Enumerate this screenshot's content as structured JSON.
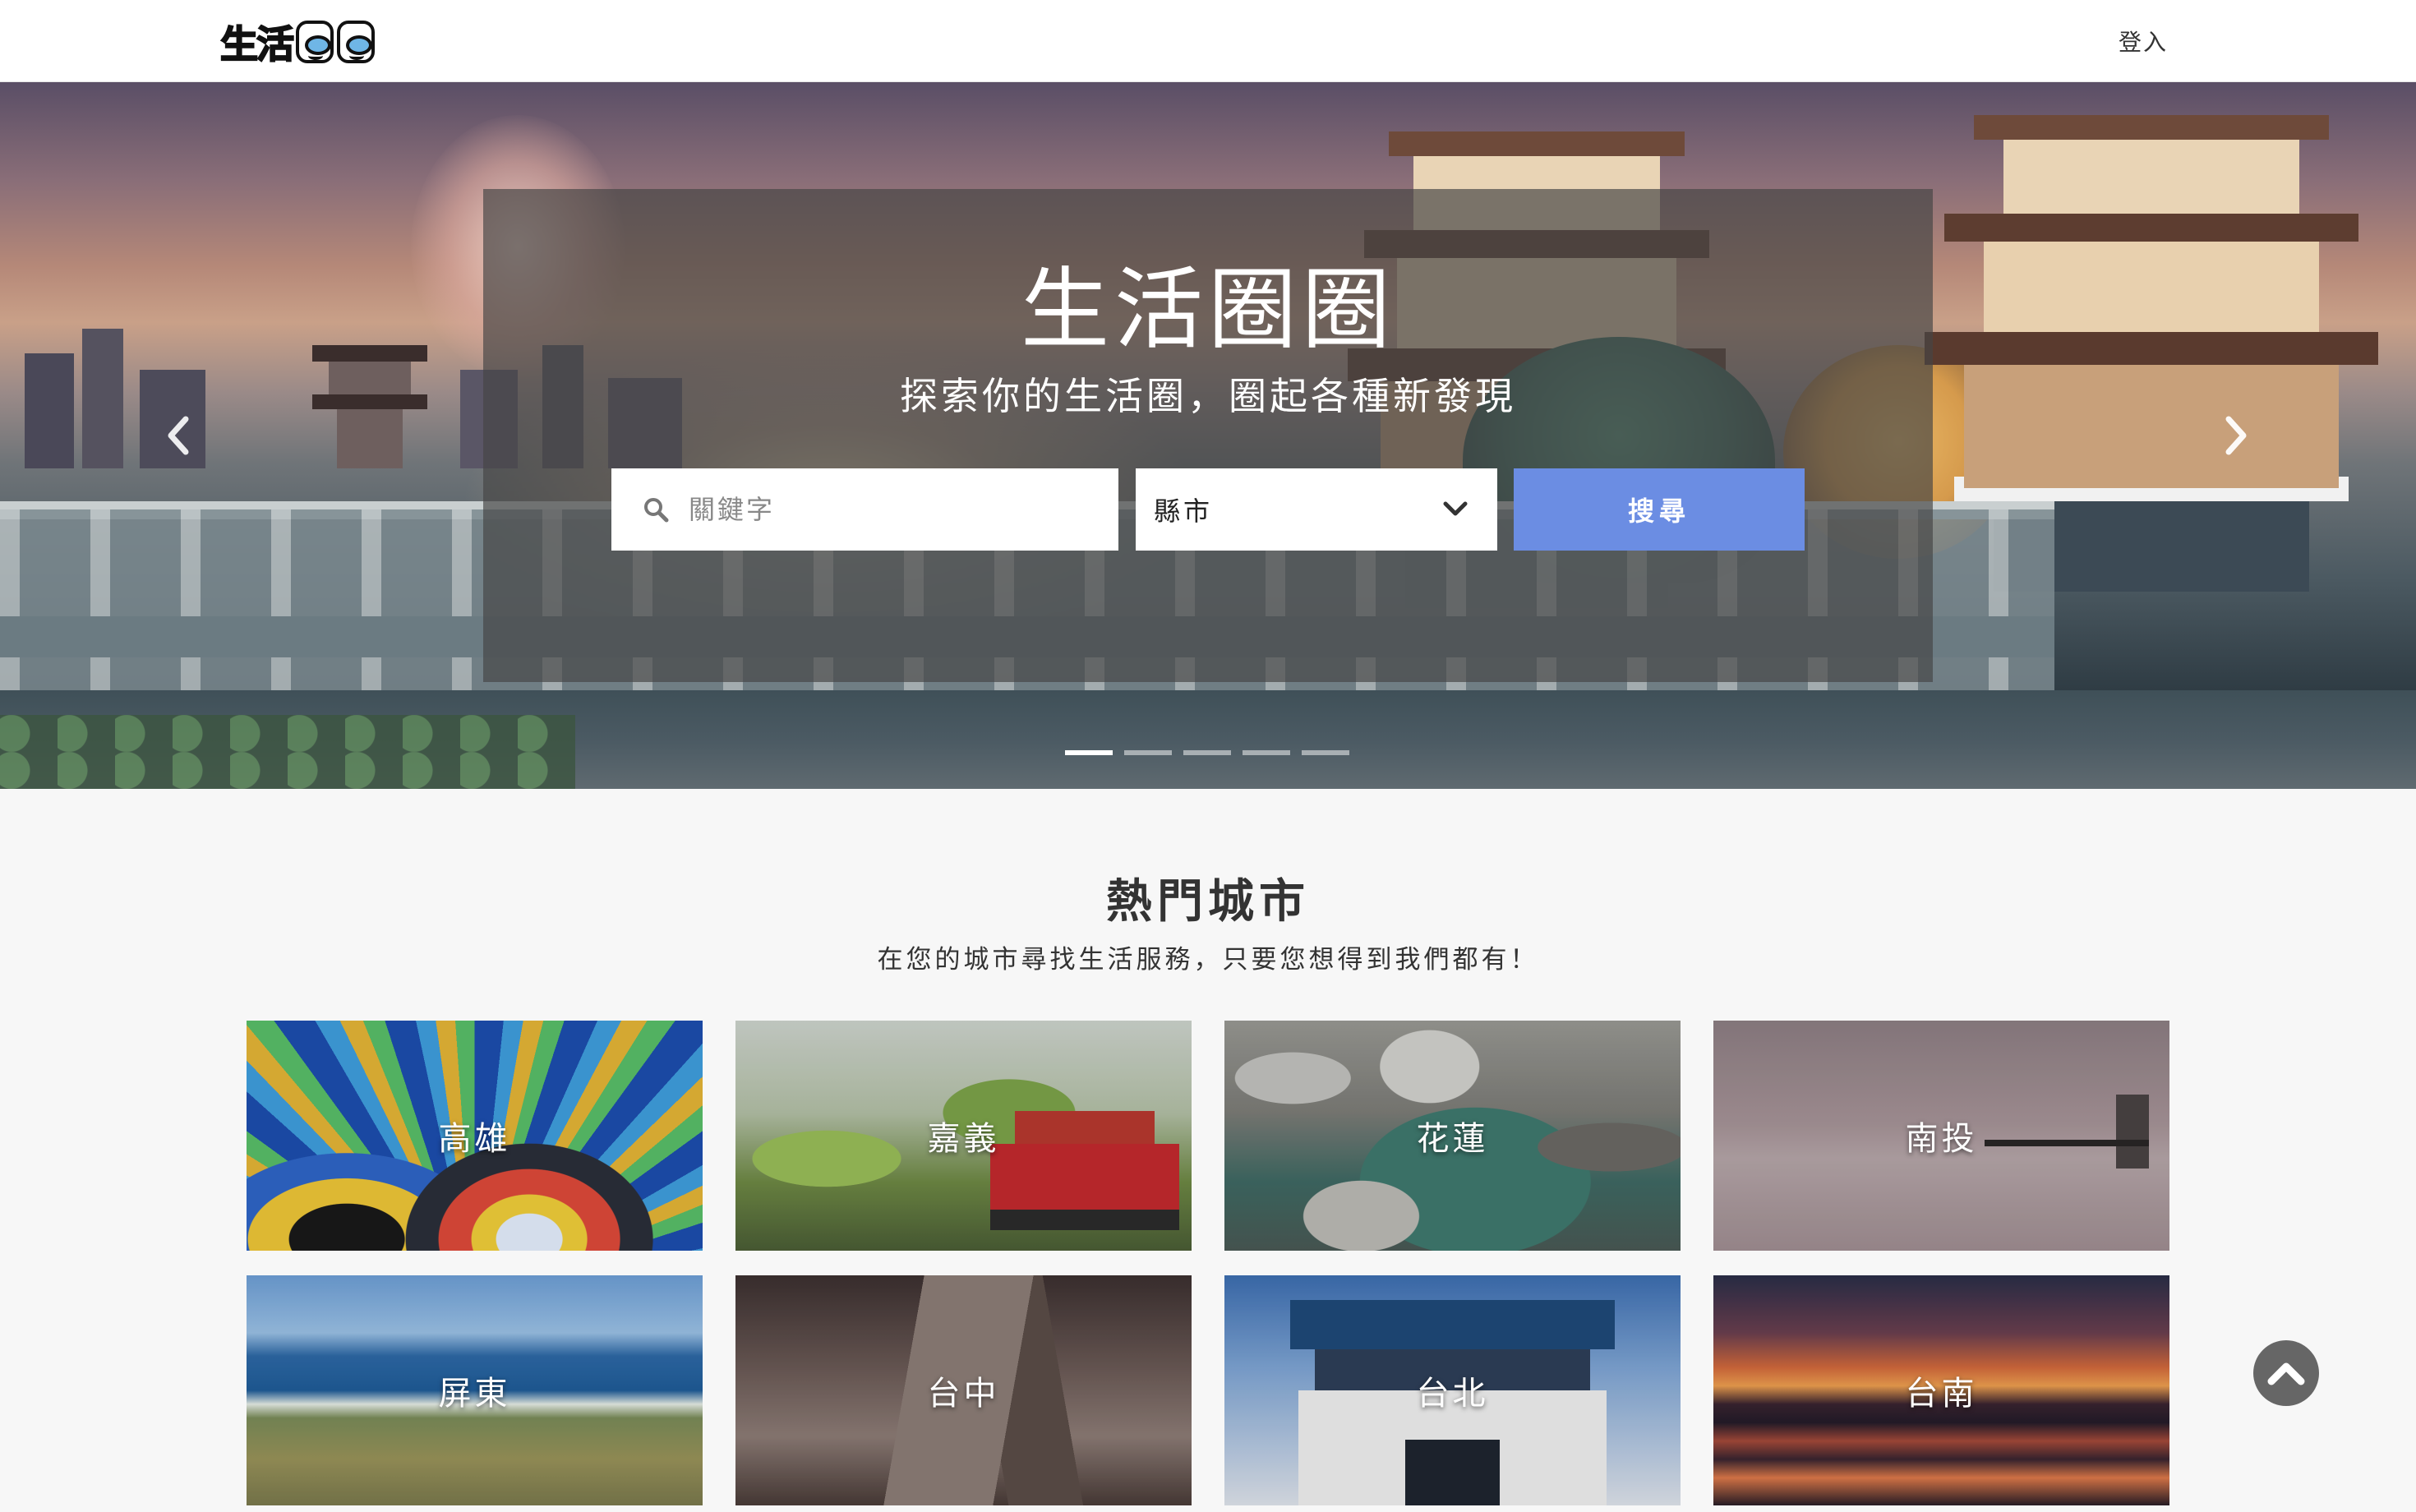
{
  "navbar": {
    "logo_text": "生活圈圈",
    "login_label": "登入"
  },
  "hero": {
    "title": "生活圈圈",
    "subtitle": "探索你的生活圈，圈起各種新發現",
    "search": {
      "placeholder": "關鍵字",
      "icon": "search-icon"
    },
    "city_select": {
      "selected": "縣市",
      "icon": "chevron-down-icon"
    },
    "search_button_label": "搜尋",
    "carousel": {
      "slide_count": 5,
      "active_index": 0,
      "prev_icon": "chevron-left-icon",
      "next_icon": "chevron-right-icon"
    }
  },
  "cities_section": {
    "title": "熱門城市",
    "subtitle": "在您的城市尋找生活服務，只要您想得到我們都有！",
    "cities": [
      {
        "name": "高雄"
      },
      {
        "name": "嘉義"
      },
      {
        "name": "花蓮"
      },
      {
        "name": "南投"
      },
      {
        "name": "屏東"
      },
      {
        "name": "台中"
      },
      {
        "name": "台北"
      },
      {
        "name": "台南"
      }
    ]
  },
  "back_to_top": {
    "icon": "chevron-up-icon"
  },
  "colors": {
    "accent": "#6b8de3",
    "overlay": "#464646",
    "page_bg": "#f7f7f7"
  }
}
